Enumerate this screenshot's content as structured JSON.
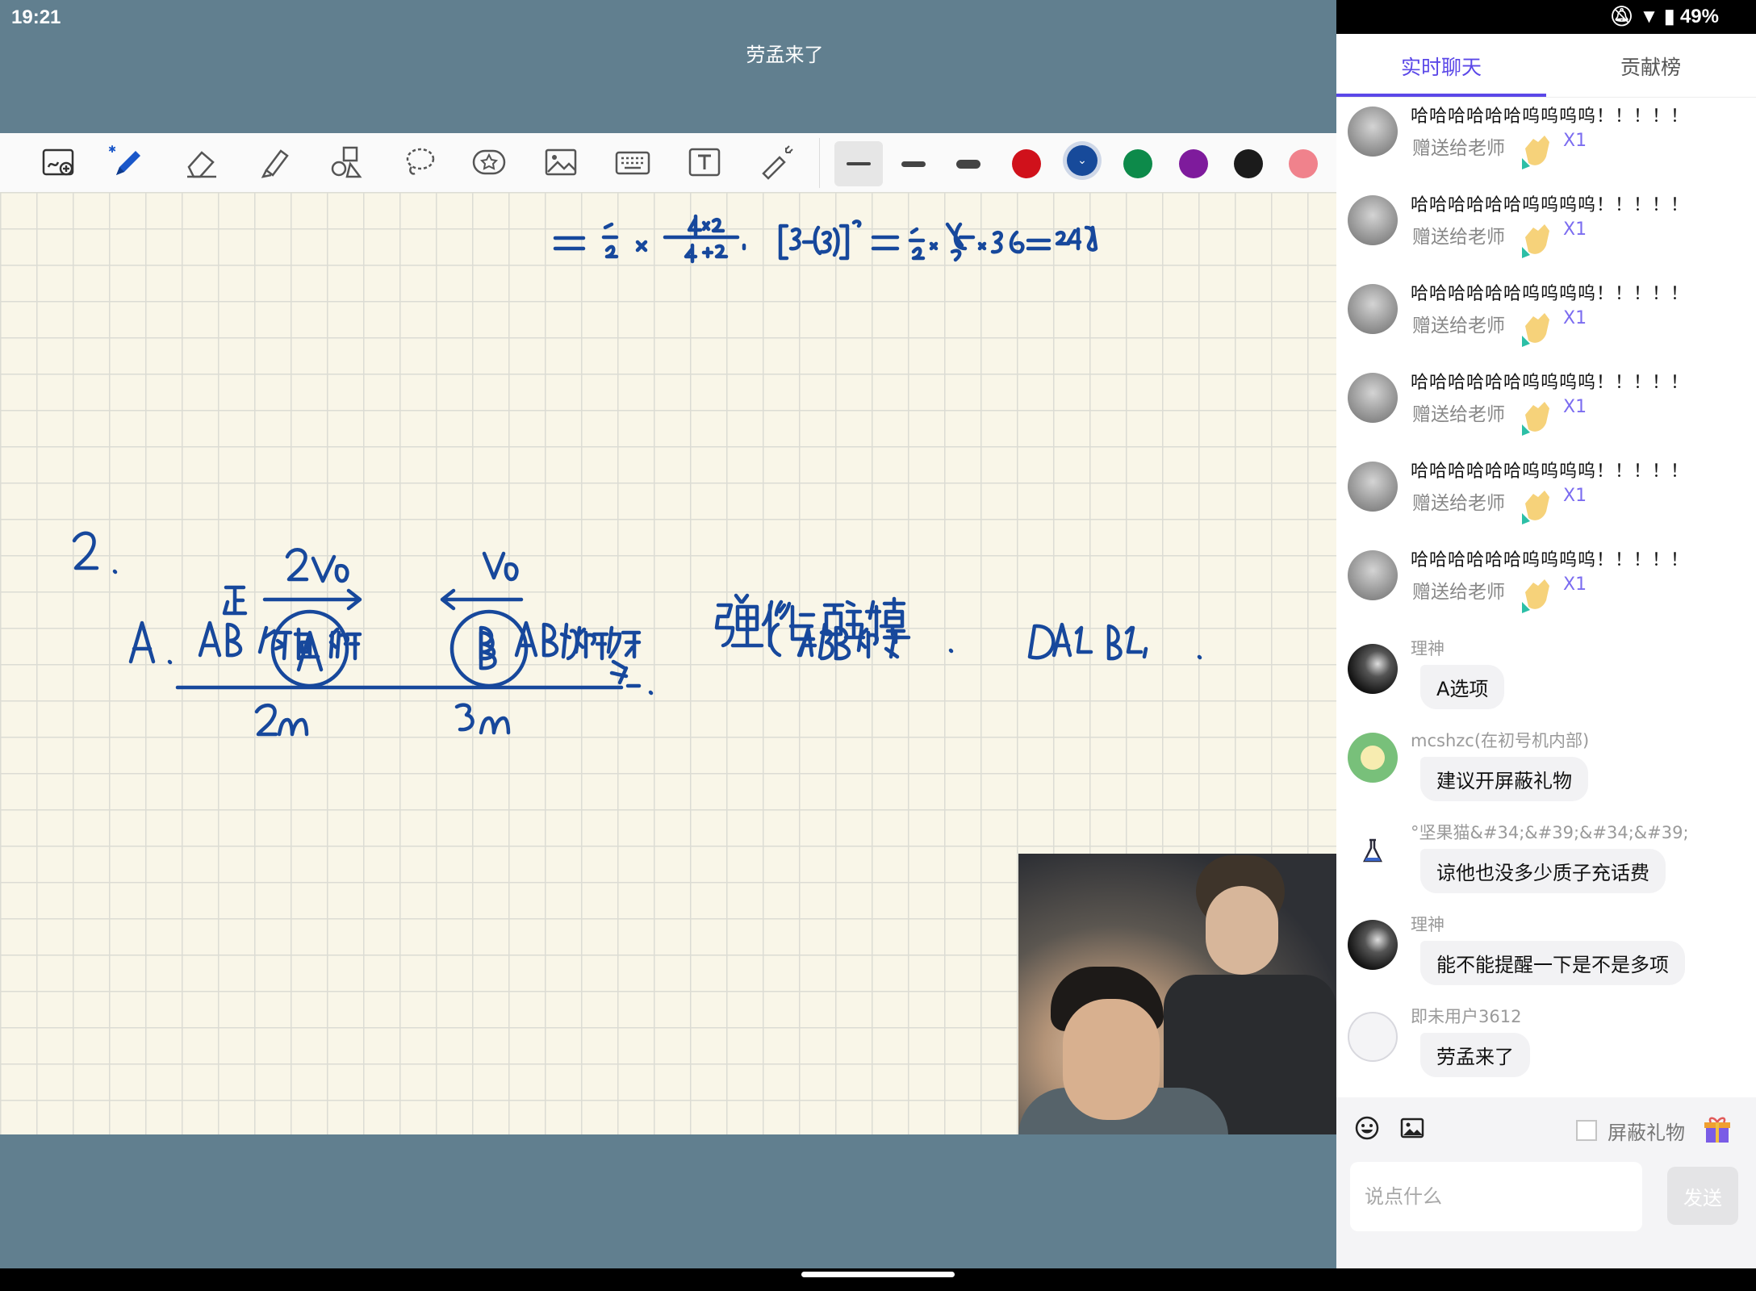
{
  "status_bar": {
    "time": "19:21",
    "battery": "49%"
  },
  "window_title": "劳孟来了",
  "toolbar": {
    "tools": [
      "whiteboard-add-icon",
      "pen-icon",
      "eraser-icon",
      "highlighter-icon",
      "shapes-icon",
      "lasso-icon",
      "sticker-icon",
      "image-icon",
      "keyboard-icon",
      "text-icon",
      "laser-pointer-icon"
    ],
    "stroke_sizes": [
      "thin",
      "medium",
      "thick"
    ],
    "selected_stroke": "thin",
    "colors": [
      "#d0111b",
      "#174a9a",
      "#0d8a4a",
      "#7e1b9c",
      "#1b1b1b",
      "#f0828c"
    ],
    "selected_color": "#174a9a"
  },
  "chat_panel": {
    "tabs": [
      "实时聊天",
      "贡献榜"
    ],
    "active_tab": "实时聊天",
    "gift_messages": [
      {
        "text": "哈哈哈哈哈哈呜呜呜呜！！！！！",
        "sub": "赠送给老师",
        "count": "X1"
      },
      {
        "text": "哈哈哈哈哈哈呜呜呜呜！！！！！",
        "sub": "赠送给老师",
        "count": "X1"
      },
      {
        "text": "哈哈哈哈哈哈呜呜呜呜！！！！！",
        "sub": "赠送给老师",
        "count": "X1"
      },
      {
        "text": "哈哈哈哈哈哈呜呜呜呜！！！！！",
        "sub": "赠送给老师",
        "count": "X1"
      },
      {
        "text": "哈哈哈哈哈哈呜呜呜呜！！！！！",
        "sub": "赠送给老师",
        "count": "X1"
      },
      {
        "text": "哈哈哈哈哈哈呜呜呜呜！！！！！",
        "sub": "赠送给老师",
        "count": "X1"
      }
    ],
    "messages": [
      {
        "user": "理神",
        "text": "A选项"
      },
      {
        "user": "mcshzc(在初号机内部)",
        "text": "建议开屏蔽礼物"
      },
      {
        "user": "°坚果猫&#34;&#39;&#34;&#39;",
        "text": "谅他也没多少质子充话费"
      },
      {
        "user": "理神",
        "text": "能不能提醒一下是不是多项"
      },
      {
        "user": "即未用户3612",
        "text": "劳孟来了"
      }
    ],
    "block_gifts_label": "屏蔽礼物",
    "input_placeholder": "说点什么",
    "send_label": "发送"
  }
}
